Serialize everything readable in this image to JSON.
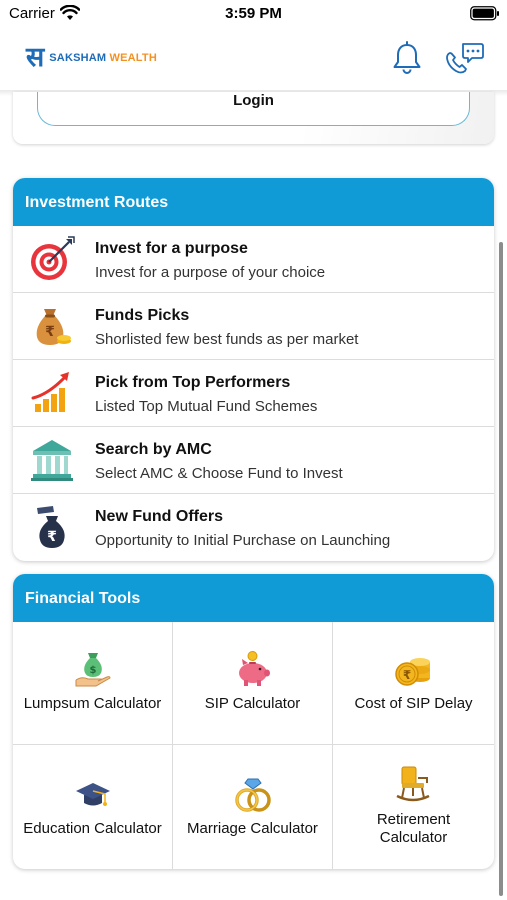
{
  "status_bar": {
    "carrier": "Carrier",
    "time": "3:59 PM"
  },
  "header": {
    "logo_mark": "स",
    "logo_saksham": "SAKSHAM",
    "logo_wealth": " WEALTH"
  },
  "login": {
    "label": "Login"
  },
  "investment_routes": {
    "title": "Investment Routes",
    "items": [
      {
        "title": "Invest for a purpose",
        "subtitle": "Invest for a purpose of your choice",
        "icon": "target-icon"
      },
      {
        "title": "Funds Picks",
        "subtitle": "Shorlisted few best funds as per market",
        "icon": "money-bag-icon"
      },
      {
        "title": "Pick from Top Performers",
        "subtitle": "Listed Top Mutual Fund Schemes",
        "icon": "growth-chart-icon"
      },
      {
        "title": "Search by AMC",
        "subtitle": "Select AMC & Choose Fund to Invest",
        "icon": "bank-icon"
      },
      {
        "title": "New Fund Offers",
        "subtitle": "Opportunity to Initial Purchase on Launching",
        "icon": "rupee-bag-icon"
      }
    ]
  },
  "financial_tools": {
    "title": "Financial Tools",
    "items": [
      {
        "label": "Lumpsum Calculator",
        "icon": "money-hand-icon"
      },
      {
        "label": "SIP Calculator",
        "icon": "piggy-bank-icon"
      },
      {
        "label": "Cost of SIP Delay",
        "icon": "coins-icon"
      },
      {
        "label": "Education Calculator",
        "icon": "graduation-cap-icon"
      },
      {
        "label": "Marriage Calculator",
        "icon": "rings-icon"
      },
      {
        "label": "Retirement Calculator",
        "icon": "rocking-chair-icon"
      }
    ]
  },
  "colors": {
    "accent": "#109bd6",
    "brand_blue": "#1e6bb8",
    "brand_orange": "#f39223"
  }
}
